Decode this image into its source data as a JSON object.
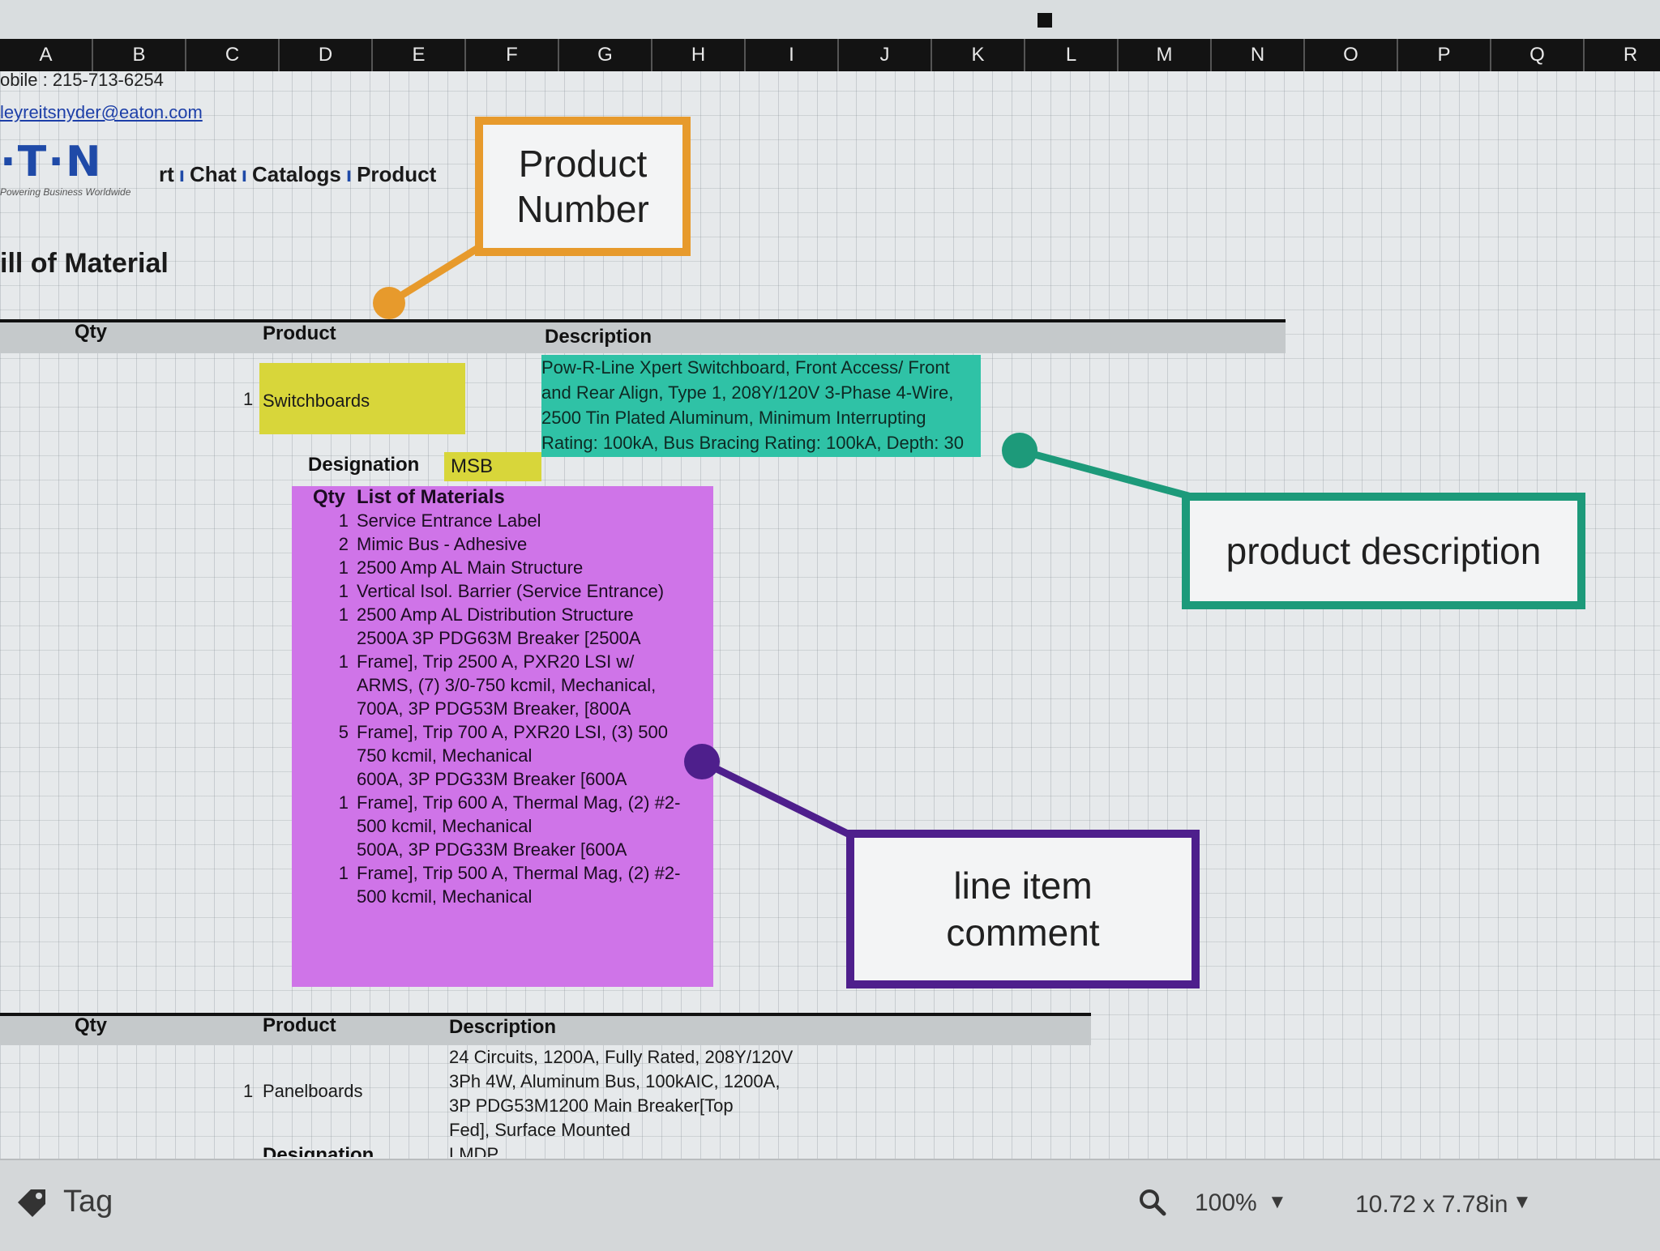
{
  "columns": [
    "A",
    "B",
    "C",
    "D",
    "E",
    "F",
    "G",
    "H",
    "I",
    "J",
    "K",
    "L",
    "M",
    "N",
    "O",
    "P",
    "Q",
    "R"
  ],
  "contact": {
    "mobile": "obile : 215-713-6254",
    "email": "leyreitsnyder@eaton.com"
  },
  "logo": {
    "text": "·T·N",
    "tagline": "Powering Business Worldwide"
  },
  "nav": {
    "items": [
      "rt",
      "Chat",
      "Catalogs",
      "Product"
    ],
    "separator": "ı"
  },
  "page_title": "ill of Material",
  "section1": {
    "headers": {
      "qty": "Qty",
      "product": "Product",
      "description": "Description"
    },
    "row": {
      "qty": "1",
      "product": "Switchboards",
      "description_lines": [
        "Pow-R-Line Xpert Switchboard, Front Access/ Front",
        "and Rear Align, Type 1, 208Y/120V 3-Phase 4-Wire,",
        "2500 Tin Plated Aluminum, Minimum Interrupting",
        "Rating: 100kA, Bus Bracing Rating: 100kA, Depth: 30"
      ]
    },
    "designation_label": "Designation",
    "designation_value": "MSB",
    "materials": {
      "header_qty": "Qty",
      "header_title": "List of Materials",
      "rows": [
        {
          "qty": "1",
          "lines": [
            "Service Entrance Label"
          ]
        },
        {
          "qty": "2",
          "lines": [
            "Mimic Bus - Adhesive"
          ]
        },
        {
          "qty": "1",
          "lines": [
            "2500 Amp AL Main Structure"
          ]
        },
        {
          "qty": "1",
          "lines": [
            "Vertical Isol. Barrier (Service Entrance)"
          ]
        },
        {
          "qty": "1",
          "lines": [
            "2500 Amp AL Distribution Structure"
          ]
        },
        {
          "qty": "1",
          "lines": [
            "2500A 3P PDG63M Breaker [2500A",
            "Frame], Trip 2500 A, PXR20 LSI w/",
            "ARMS, (7) 3/0-750 kcmil, Mechanical,"
          ]
        },
        {
          "qty": "5",
          "lines": [
            "700A, 3P PDG53M Breaker, [800A",
            "Frame], Trip 700 A, PXR20 LSI, (3) 500",
            "750 kcmil, Mechanical"
          ]
        },
        {
          "qty": "1",
          "lines": [
            "600A, 3P PDG33M Breaker [600A",
            "Frame], Trip 600 A, Thermal Mag, (2) #2-",
            "500 kcmil, Mechanical"
          ]
        },
        {
          "qty": "1",
          "lines": [
            "500A, 3P PDG33M Breaker [600A",
            "Frame], Trip 500 A, Thermal Mag, (2) #2-",
            "500 kcmil, Mechanical"
          ]
        }
      ]
    }
  },
  "section2": {
    "headers": {
      "qty": "Qty",
      "product": "Product",
      "description": "Description"
    },
    "row": {
      "qty": "1",
      "product": "Panelboards",
      "description_lines": [
        "24 Circuits, 1200A, Fully Rated, 208Y/120V",
        "3Ph 4W, Aluminum Bus, 100kAIC, 1200A,",
        "3P PDG53M1200 Main Breaker[Top",
        "Fed], Surface Mounted"
      ]
    },
    "designation_partial": "Designation",
    "designation_value_partial": "LMDP"
  },
  "callouts": {
    "product_number": [
      "Product",
      "Number"
    ],
    "product_description": "product description",
    "line_item_comment": [
      "line item",
      "comment"
    ]
  },
  "colors": {
    "product_number": "#e79a2c",
    "product_description": "#1d9a7a",
    "line_item_comment": "#4e1f8c",
    "materials_fill": "#cf74e8",
    "description_fill": "#2fc2a6",
    "product_fill": "#d8d63a"
  },
  "statusbar": {
    "tag_icon": "tag-icon",
    "tag_label": "Tag",
    "zoom_icon": "search-icon",
    "zoom": "100%",
    "page_size": "10.72 x 7.78in"
  }
}
